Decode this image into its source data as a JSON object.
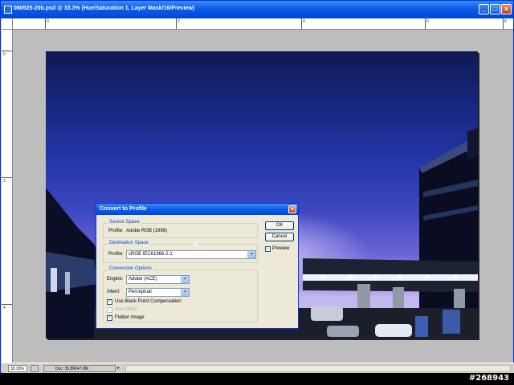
{
  "window": {
    "title": "080925-20b.psd @ 33.3% (Hue/Saturation 1, Layer Mask/16/Preview)",
    "controls": {
      "minimize": "_",
      "maximize": "□",
      "close": "×"
    }
  },
  "rulers": {
    "top_labels": [
      "0",
      "2",
      "4",
      "6",
      "8"
    ],
    "left_labels": [
      "0",
      "2",
      "4"
    ]
  },
  "status": {
    "zoom": "33.33%",
    "doc_info": "Doc: 39.8M/47.8M"
  },
  "dialog": {
    "title": "Convert to Profile",
    "close": "×",
    "source": {
      "legend": "Source Space",
      "profile_label": "Profile:",
      "profile_value": "Adobe RGB (1998)"
    },
    "destination": {
      "legend": "Destination Space",
      "profile_label": "Profile:",
      "profile_value": "sRGB IEC61966-2.1"
    },
    "conversion": {
      "legend": "Conversion Options",
      "engine_label": "Engine:",
      "engine_value": "Adobe (ACE)",
      "intent_label": "Intent:",
      "intent_value": "Perceptual",
      "black_point_label": "Use Black Point Compensation",
      "black_point_checked": true,
      "dither_label": "Use Dither",
      "dither_checked": false,
      "flatten_label": "Flatten Image",
      "flatten_checked": true
    },
    "ok_label": "OK",
    "cancel_label": "Cancel",
    "preview_label": "Preview",
    "preview_checked": true
  },
  "watermark": "#268943"
}
